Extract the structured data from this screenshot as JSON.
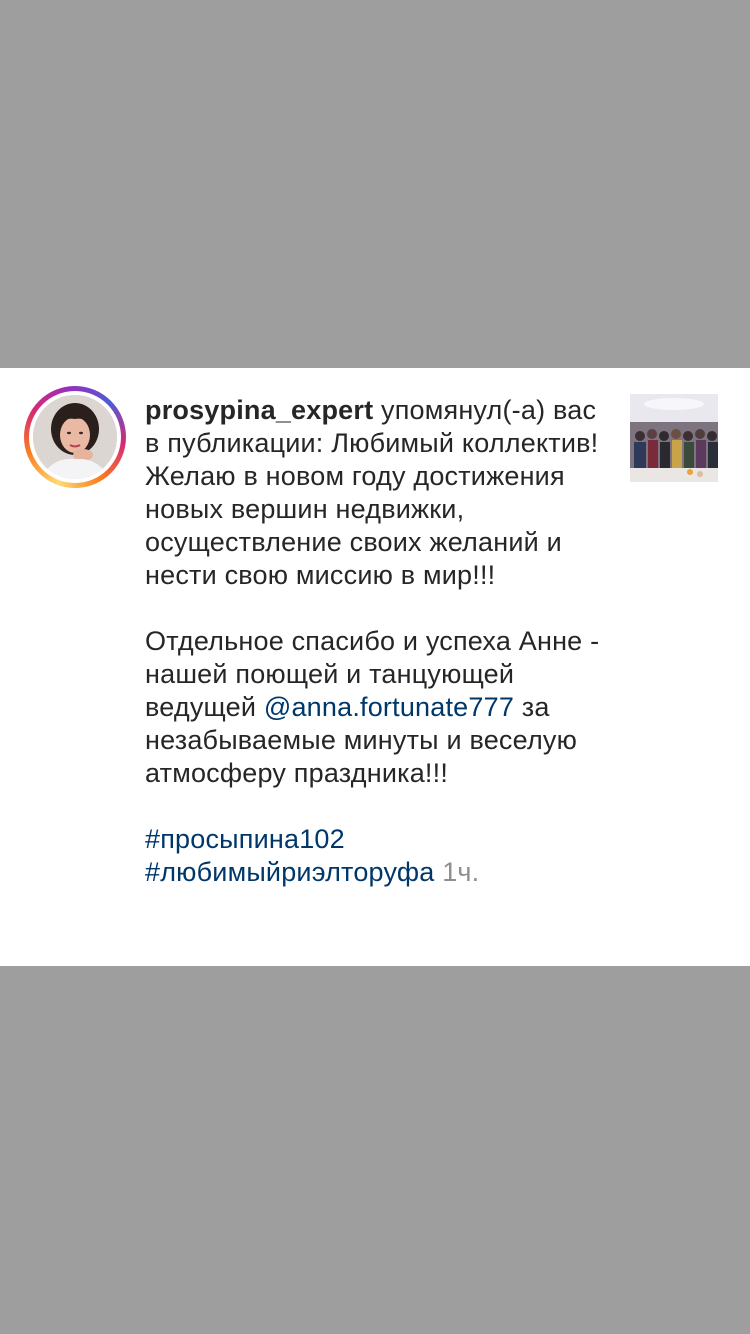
{
  "notification": {
    "username": "prosypina_expert",
    "action": " упомянул(-а) вас в публикации: ",
    "caption_line1": "Любимый коллектив! Желаю в новом году достижения новых вершин недвижки, осуществление своих желаний и нести свою миссию в мир!!!",
    "caption_line2_pre": "Отдельное спасибо и успеха Анне - нашей поющей и танцующей ведущей ",
    "mention": "@anna.fortunate777",
    "caption_line2_post": "  за незабываемые минуты и веселую атмосферу праздника!!!",
    "hashtag1": "#просыпина102",
    "hashtag2": "#любимыйриэлторуфа",
    "time": "1ч."
  },
  "colors": {
    "overlay": "#9e9e9e",
    "text": "#262626",
    "link": "#00376b",
    "muted": "#8e8e8e"
  },
  "icons": {
    "avatar": "profile-photo",
    "thumbnail": "post-thumbnail-group-photo"
  }
}
